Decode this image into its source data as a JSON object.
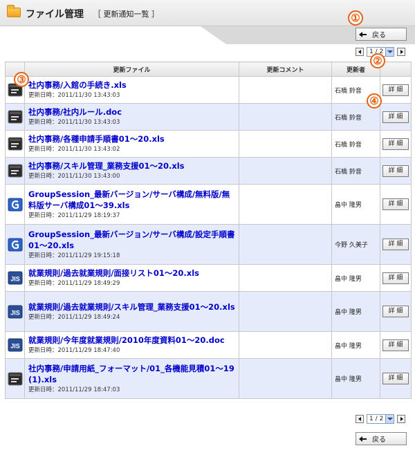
{
  "header": {
    "title": "ファイル管理",
    "subtitle": "［ 更新通知一覧 ］"
  },
  "back_label": "戻る",
  "pager": {
    "current": "1 / 2"
  },
  "table": {
    "columns": [
      "更新ファイル",
      "更新コメント",
      "更新者"
    ],
    "detail_label": "詳 細",
    "rows": [
      {
        "icon": "terminal-file-icon",
        "name": "社内事務/入館の手続き.xls",
        "date": "更新日時：2011/11/30 13:43:03",
        "comment": "",
        "updater": "石橋 鈴音"
      },
      {
        "icon": "terminal-file-icon",
        "name": "社内事務/社内ルール.doc",
        "date": "更新日時：2011/11/30 13:43:03",
        "comment": "",
        "updater": "石橋 鈴音"
      },
      {
        "icon": "terminal-file-icon",
        "name": "社内事務/各種申請手順書01～20.xls",
        "date": "更新日時：2011/11/30 13:43:02",
        "comment": "",
        "updater": "石橋 鈴音"
      },
      {
        "icon": "terminal-file-icon",
        "name": "社内事務/スキル管理_業務支援01～20.xls",
        "date": "更新日時：2011/11/30 13:43:00",
        "comment": "",
        "updater": "石橋 鈴音"
      },
      {
        "icon": "groupsession-file-icon",
        "name": "GroupSession_最新バージョン/サーバ構成/無料版/無料版サーバ構成01～39.xls",
        "date": "更新日時：2011/11/29 18:19:37",
        "comment": "",
        "updater": "畠中 隆男"
      },
      {
        "icon": "groupsession-file-icon",
        "name": "GroupSession_最新バージョン/サーバ構成/設定手順書01～20.xls",
        "date": "更新日時：2011/11/29 19:15:18",
        "comment": "",
        "updater": "今野 久美子"
      },
      {
        "icon": "jis-file-icon",
        "name": "就業規則/過去就業規則/面接リスト01～20.xls",
        "date": "更新日時：2011/11/29 18:49:29",
        "comment": "",
        "updater": "畠中 隆男"
      },
      {
        "icon": "jis-file-icon",
        "name": "就業規則/過去就業規則/スキル管理_業務支援01～20.xls",
        "date": "更新日時：2011/11/29 18:49:24",
        "comment": "",
        "updater": "畠中 隆男"
      },
      {
        "icon": "jis-file-icon",
        "name": "就業規則/今年度就業規則/2010年度資料01～20.doc",
        "date": "更新日時：2011/11/29 18:47:40",
        "comment": "",
        "updater": "畠中 隆男"
      },
      {
        "icon": "terminal-file-icon",
        "name": "社内事務/申請用紙_フォーマット/01_各機能見積01～19 (1).xls",
        "date": "更新日時：2011/11/29 18:47:03",
        "comment": "",
        "updater": "畠中 隆男"
      }
    ]
  },
  "callouts": [
    "①",
    "②",
    "③",
    "④"
  ]
}
